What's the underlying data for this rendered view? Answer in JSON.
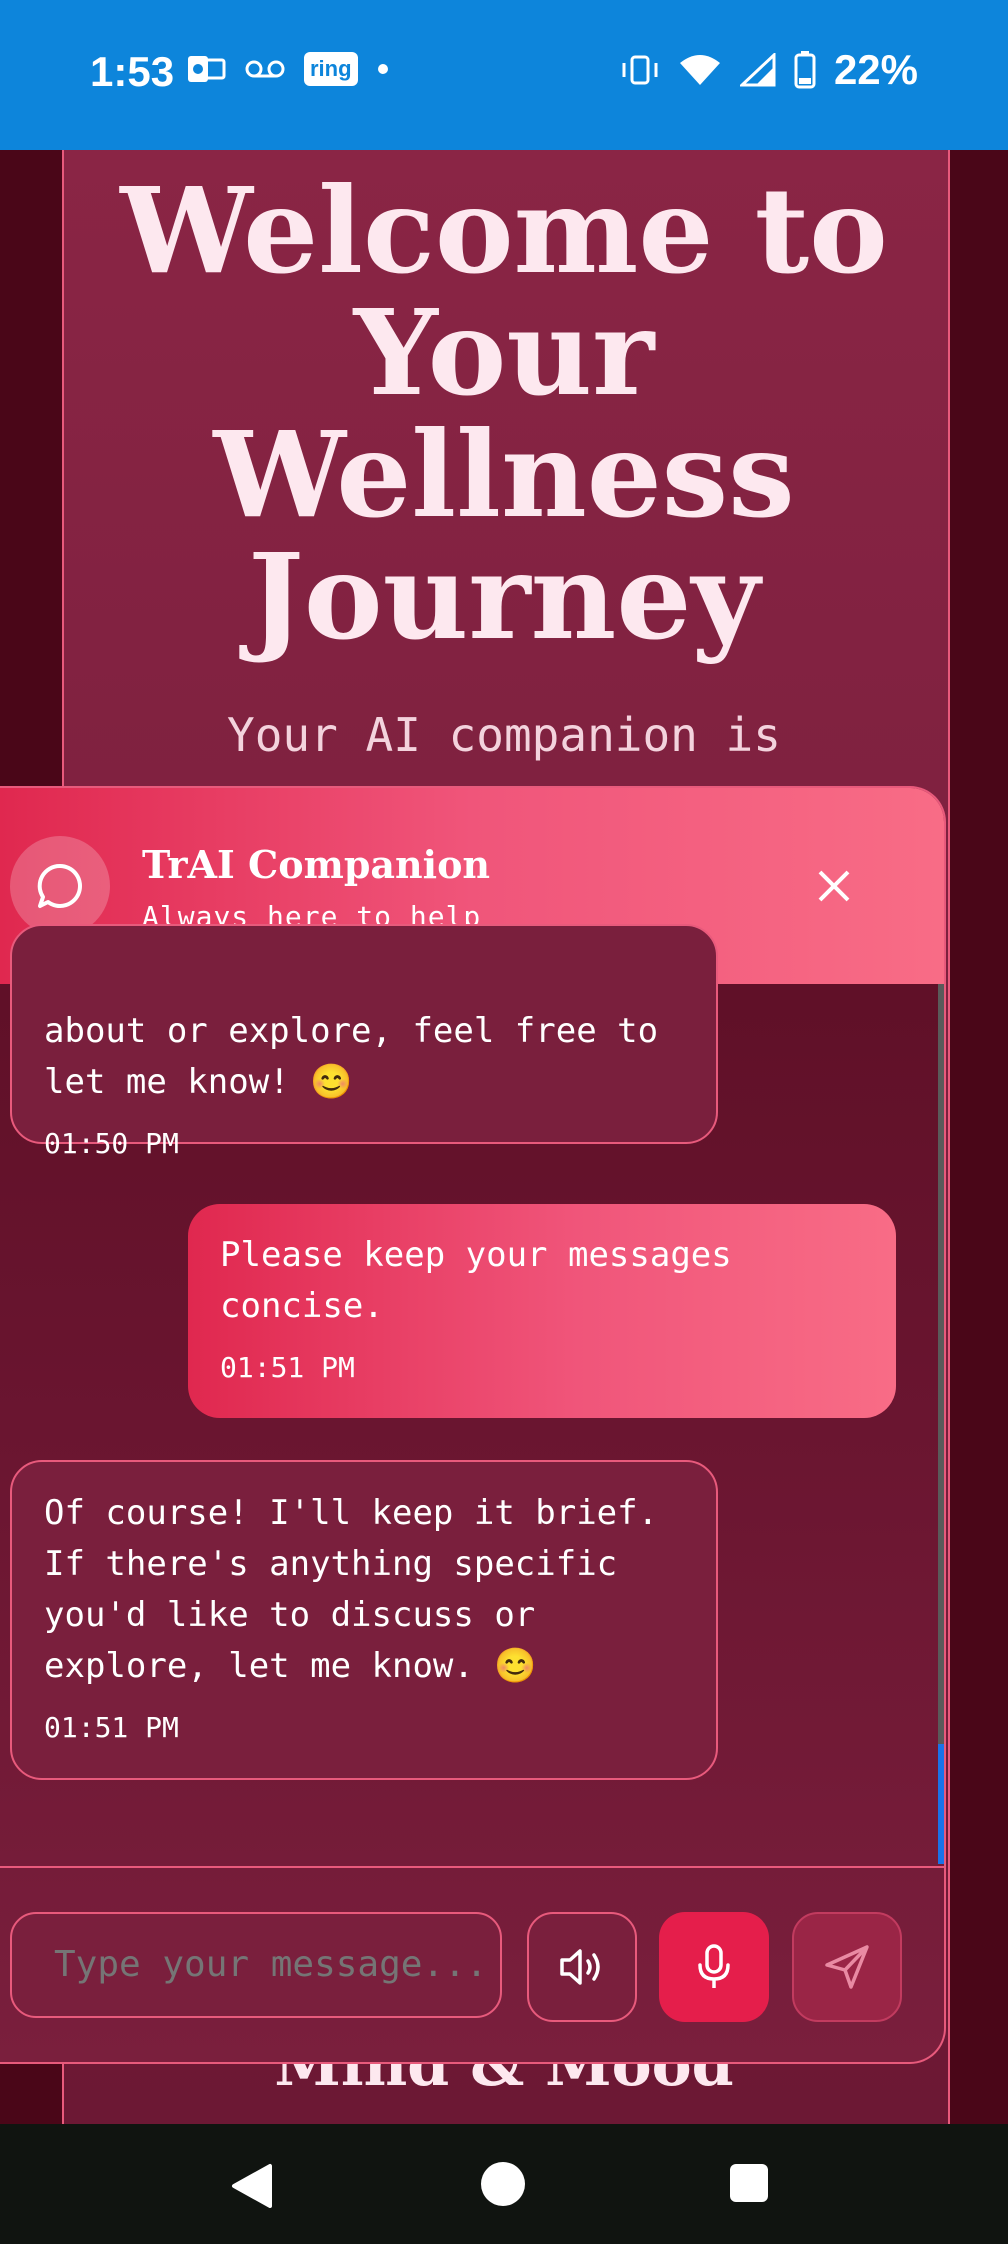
{
  "status_bar": {
    "time": "1:53",
    "ring_label": "ring",
    "battery": "22%"
  },
  "background": {
    "title": "Welcome to Your Wellness Journey",
    "subtitle": "Your AI companion is",
    "bottom_heading": "Mind & Mood"
  },
  "chat": {
    "header_title": "TrAI Companion",
    "header_subtitle": "Always here to help",
    "messages": [
      {
        "role": "bot",
        "text": "about or explore, feel free to let me know! 😊",
        "time": "01:50 PM"
      },
      {
        "role": "user",
        "text": "Please keep your messages concise.",
        "time": "01:51 PM"
      },
      {
        "role": "bot",
        "text": "Of course! I'll keep it brief. If there's anything specific you'd like to discuss or explore, let me know. 😊",
        "time": "01:51 PM"
      }
    ],
    "input_placeholder": "Type your message..."
  },
  "colors": {
    "accent": "#e51e4b",
    "status_bar": "#0d85db"
  }
}
